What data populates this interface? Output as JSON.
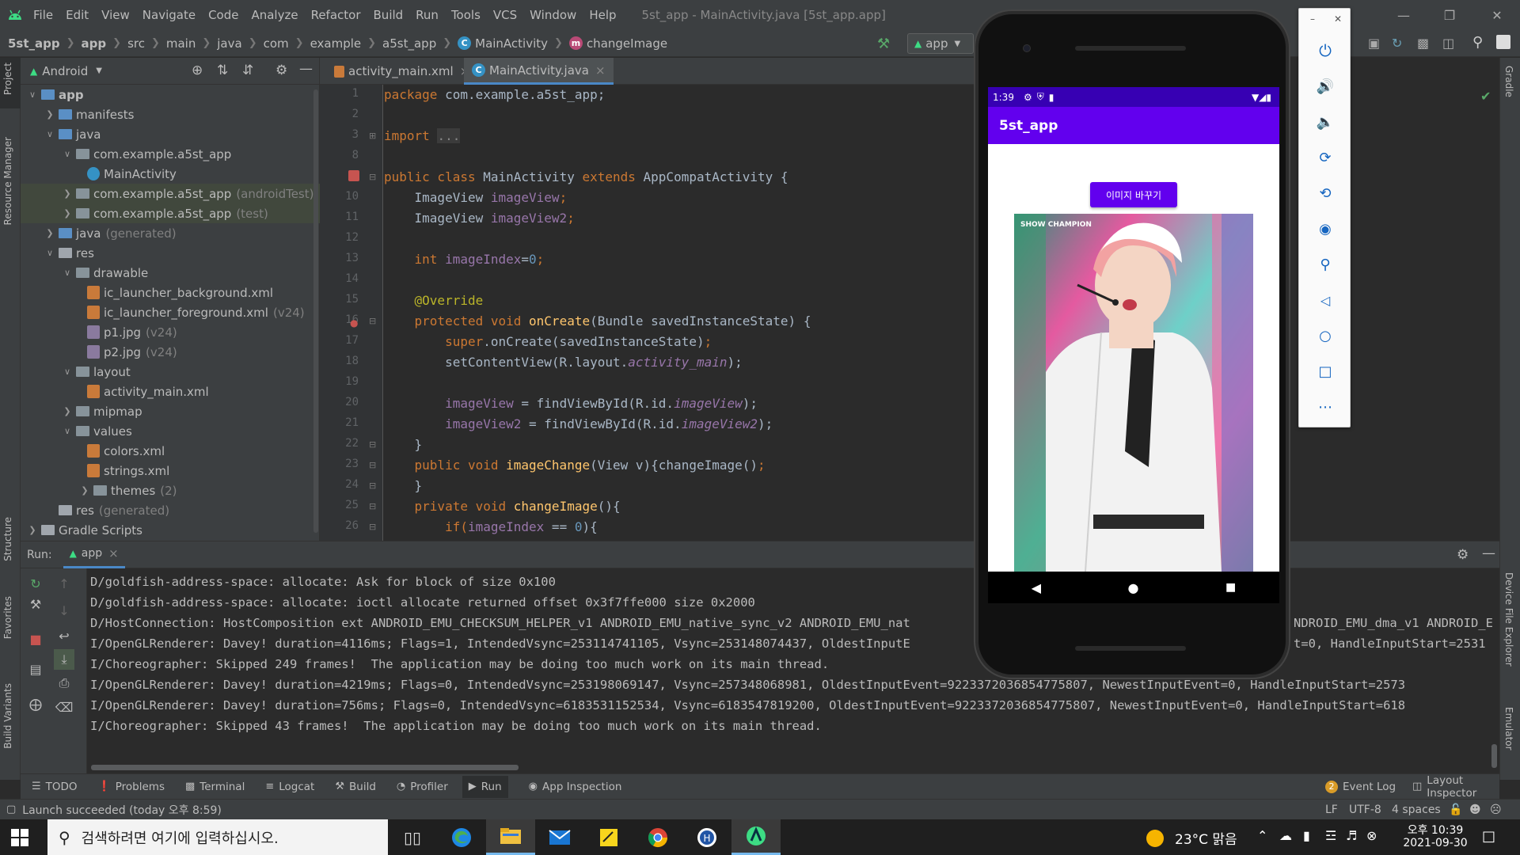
{
  "window": {
    "title": "5st_app - MainActivity.java [5st_app.app]",
    "menu": [
      "File",
      "Edit",
      "View",
      "Navigate",
      "Code",
      "Analyze",
      "Refactor",
      "Build",
      "Run",
      "Tools",
      "VCS",
      "Window",
      "Help"
    ]
  },
  "breadcrumb": [
    "5st_app",
    "app",
    "src",
    "main",
    "java",
    "com",
    "example",
    "a5st_app",
    "MainActivity",
    "changeImage"
  ],
  "run_config": "app",
  "project_panel": {
    "view": "Android",
    "tree": [
      {
        "label": "app",
        "extra": ""
      },
      {
        "label": "manifests",
        "extra": ""
      },
      {
        "label": "java",
        "extra": ""
      },
      {
        "label": "com.example.a5st_app",
        "extra": ""
      },
      {
        "label": "MainActivity",
        "extra": ""
      },
      {
        "label": "com.example.a5st_app",
        "extra": "(androidTest)"
      },
      {
        "label": "com.example.a5st_app",
        "extra": "(test)"
      },
      {
        "label": "java",
        "extra": "(generated)"
      },
      {
        "label": "res",
        "extra": ""
      },
      {
        "label": "drawable",
        "extra": ""
      },
      {
        "label": "ic_launcher_background.xml",
        "extra": ""
      },
      {
        "label": "ic_launcher_foreground.xml",
        "extra": "(v24)"
      },
      {
        "label": "p1.jpg",
        "extra": "(v24)"
      },
      {
        "label": "p2.jpg",
        "extra": "(v24)"
      },
      {
        "label": "layout",
        "extra": ""
      },
      {
        "label": "activity_main.xml",
        "extra": ""
      },
      {
        "label": "mipmap",
        "extra": ""
      },
      {
        "label": "values",
        "extra": ""
      },
      {
        "label": "colors.xml",
        "extra": ""
      },
      {
        "label": "strings.xml",
        "extra": ""
      },
      {
        "label": "themes",
        "extra": "(2)"
      },
      {
        "label": "res",
        "extra": "(generated)"
      },
      {
        "label": "Gradle Scripts",
        "extra": ""
      }
    ]
  },
  "left_stripe": {
    "project": "Project",
    "resource_manager": "Resource Manager",
    "structure": "Structure",
    "favorites": "Favorites",
    "build_variants": "Build Variants"
  },
  "right_stripe": {
    "gradle": "Gradle",
    "device_file_explorer": "Device File Explorer",
    "emulator": "Emulator"
  },
  "editor": {
    "tabs": [
      "activity_main.xml",
      "MainActivity.java"
    ],
    "line_numbers": [
      "1",
      "2",
      "3",
      "8",
      "9",
      "10",
      "11",
      "12",
      "13",
      "14",
      "15",
      "16",
      "17",
      "18",
      "19",
      "20",
      "21",
      "22",
      "23",
      "24",
      "25",
      "26"
    ],
    "code": {
      "l1a": "package ",
      "l1b": "com.example.a5st_app;",
      "l3a": "import ",
      "l3b": "...",
      "l9a": "public class ",
      "l9b": "MainActivity ",
      "l9c": "extends ",
      "l9d": "AppCompatActivity {",
      "l10a": "    ImageView ",
      "l10b": "imageView",
      "l10c": ";",
      "l11a": "    ImageView ",
      "l11b": "imageView2",
      "l11c": ";",
      "l13a": "    int ",
      "l13b": "imageIndex",
      "l13c": "=",
      "l13d": "0",
      "l13e": ";",
      "l15": "    @Override",
      "l16a": "    protected void ",
      "l16b": "onCreate",
      "l16c": "(Bundle savedInstanceState) {",
      "l17a": "        super",
      "l17b": ".onCreate(savedInstanceState)",
      "l17c": ";",
      "l18a": "        setContentView(R.layout.",
      "l18b": "activity_main",
      "l18c": ");",
      "l20a": "        ",
      "l20b": "imageView",
      "l20c": " = findViewById(R.id.",
      "l20d": "imageView",
      "l20e": ");",
      "l21a": "        ",
      "l21b": "imageView2",
      "l21c": " = findViewById(R.id.",
      "l21d": "imageView2",
      "l21e": ");",
      "l22": "    }",
      "l23a": "    public void ",
      "l23b": "imageChange",
      "l23c": "(View v){changeImage()",
      "l23d": ";",
      "l24": "    }",
      "l25a": "    private void ",
      "l25b": "changeImage",
      "l25c": "(){",
      "l26a": "        if(",
      "l26b": "imageIndex",
      "l26c": " == ",
      "l26d": "0",
      "l26e": "){"
    }
  },
  "run_panel": {
    "label": "Run:",
    "tab": "app",
    "console": [
      "D/goldfish-address-space: allocate: Ask for block of size 0x100",
      "D/goldfish-address-space: allocate: ioctl allocate returned offset 0x3f7ffe000 size 0x2000",
      "D/HostConnection: HostComposition ext ANDROID_EMU_CHECKSUM_HELPER_v1 ANDROID_EMU_native_sync_v2 ANDROID_EMU_nat",
      "I/OpenGLRenderer: Davey! duration=4116ms; Flags=1, IntendedVsync=253114741105, Vsync=253148074437, OldestInputE",
      "I/Choreographer: Skipped 249 frames!  The application may be doing too much work on its main thread.",
      "I/OpenGLRenderer: Davey! duration=4219ms; Flags=0, IntendedVsync=253198069147, Vsync=257348068981, OldestInputEvent=9223372036854775807, NewestInputEvent=0, HandleInputStart=2573",
      "I/OpenGLRenderer: Davey! duration=756ms; Flags=0, IntendedVsync=6183531152534, Vsync=6183547819200, OldestInputEvent=9223372036854775807, NewestInputEvent=0, HandleInputStart=618",
      "I/Choreographer: Skipped 43 frames!  The application may be doing too much work on its main thread."
    ],
    "console_tail_2": "NDROID_EMU_dma_v1 ANDROID_E",
    "console_tail_3": "t=0, HandleInputStart=2531"
  },
  "bottom_tools": [
    "TODO",
    "Problems",
    "Terminal",
    "Logcat",
    "Build",
    "Profiler",
    "Run",
    "App Inspection"
  ],
  "bottom_right": {
    "event_log_count": "2",
    "event_log": "Event Log",
    "layout_inspector": "Layout Inspector"
  },
  "status": {
    "message": "Launch succeeded (today 오후 8:59)",
    "line_sep": "LF",
    "encoding": "UTF-8",
    "indent": "4 spaces"
  },
  "emulator": {
    "time": "1:39",
    "app_title": "5st_app",
    "button_label": "이미지 바꾸기",
    "photo_logo": "SHOW CHAMPION"
  },
  "taskbar": {
    "search_placeholder": "검색하려면 여기에 입력하십시오.",
    "weather": "23°C 맑음",
    "time": "오후 10:39",
    "date": "2021-09-30"
  },
  "colors": {
    "accent": "#6200ee",
    "status_dark": "#3700b3",
    "ide_bg": "#2b2b2b",
    "panel": "#3c3f41"
  }
}
